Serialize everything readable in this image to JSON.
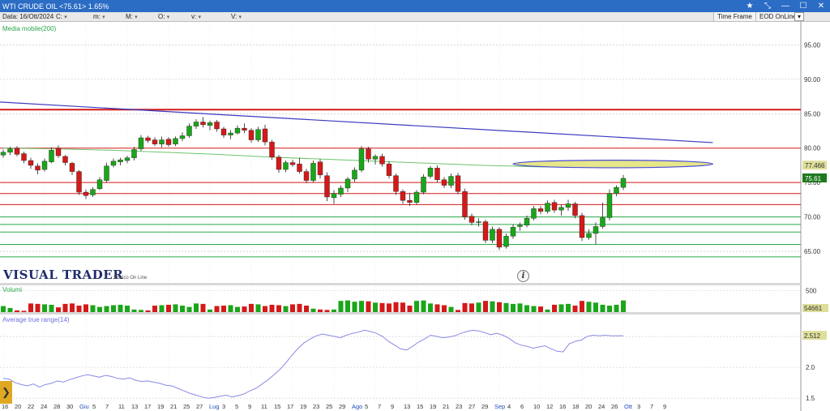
{
  "window": {
    "title": "WTI CRUDE OIL <75.61> 1.65%",
    "star": "★",
    "pin": "⤡",
    "minimize": "—",
    "maximize": "☐",
    "close": "✕"
  },
  "infobar": {
    "date_label": "Data: 16/Ott/2024",
    "c_label": "C:",
    "m_label": "m:",
    "M_label": "M:",
    "o_label": "O:",
    "v_label": "v:",
    "V_label": "V:",
    "timeframe": "Time Frame",
    "source": "EOD OnLine"
  },
  "labels": {
    "ma": "Media mobile(200)",
    "volume": "Volumi",
    "atr": "Average true range(14)",
    "logo": "VISUAL TRADER",
    "logo_sub": "Storico On Line",
    "info": "i",
    "sidetab": "❯"
  },
  "colors": {
    "up": "#1aa61a",
    "down": "#d41919",
    "ma": "#6cc46c",
    "trendline": "#3a3abf",
    "resistance": "#d41919",
    "support": "#2aa84a",
    "atr": "#8a8ae6",
    "ellipse_fill": "#e6e68a",
    "ellipse_stroke": "#4a4ad8"
  },
  "chart_data": [
    {
      "type": "candlestick",
      "title": "WTI CRUDE OIL",
      "x_ticks": [
        "16",
        "20",
        "22",
        "24",
        "28",
        "30",
        "Giu",
        "5",
        "7",
        "11",
        "13",
        "17",
        "19",
        "21",
        "25",
        "27",
        "Lug",
        "3",
        "5",
        "9",
        "11",
        "15",
        "17",
        "19",
        "23",
        "25",
        "29",
        "Ago",
        "5",
        "7",
        "9",
        "13",
        "15",
        "19",
        "21",
        "23",
        "27",
        "29",
        "Sep",
        "4",
        "6",
        "10",
        "12",
        "16",
        "18",
        "20",
        "24",
        "26",
        "Ott",
        "3",
        "7",
        "9"
      ],
      "y_ticks": [
        65,
        70,
        75,
        80,
        85,
        90,
        95
      ],
      "ylim": [
        63.0,
        98.0
      ],
      "last_price": "75.61",
      "ma_value": "77.466",
      "candles": [
        {
          "o": 79.0,
          "h": 79.8,
          "l": 78.6,
          "c": 79.4
        },
        {
          "o": 79.4,
          "h": 80.2,
          "l": 79.0,
          "c": 79.9
        },
        {
          "o": 80.0,
          "h": 80.3,
          "l": 78.8,
          "c": 79.1
        },
        {
          "o": 79.2,
          "h": 79.5,
          "l": 77.8,
          "c": 78.2
        },
        {
          "o": 78.2,
          "h": 78.6,
          "l": 77.0,
          "c": 77.5
        },
        {
          "o": 77.4,
          "h": 77.8,
          "l": 76.2,
          "c": 76.8
        },
        {
          "o": 76.9,
          "h": 78.5,
          "l": 76.6,
          "c": 78.1
        },
        {
          "o": 78.0,
          "h": 80.1,
          "l": 77.8,
          "c": 79.7
        },
        {
          "o": 80.0,
          "h": 80.4,
          "l": 78.6,
          "c": 78.9
        },
        {
          "o": 78.8,
          "h": 79.0,
          "l": 77.5,
          "c": 77.9
        },
        {
          "o": 77.8,
          "h": 78.0,
          "l": 76.1,
          "c": 76.6
        },
        {
          "o": 76.6,
          "h": 76.8,
          "l": 73.2,
          "c": 73.6
        },
        {
          "o": 73.6,
          "h": 74.0,
          "l": 72.6,
          "c": 73.1
        },
        {
          "o": 73.2,
          "h": 74.3,
          "l": 72.9,
          "c": 74.0
        },
        {
          "o": 74.1,
          "h": 75.8,
          "l": 73.9,
          "c": 75.4
        },
        {
          "o": 75.3,
          "h": 77.9,
          "l": 75.0,
          "c": 77.4
        },
        {
          "o": 77.5,
          "h": 78.5,
          "l": 77.2,
          "c": 78.1
        },
        {
          "o": 78.0,
          "h": 78.6,
          "l": 77.5,
          "c": 78.3
        },
        {
          "o": 78.2,
          "h": 78.9,
          "l": 77.8,
          "c": 78.6
        },
        {
          "o": 78.6,
          "h": 80.2,
          "l": 78.2,
          "c": 79.8
        },
        {
          "o": 79.9,
          "h": 81.9,
          "l": 79.6,
          "c": 81.5
        },
        {
          "o": 81.5,
          "h": 81.8,
          "l": 80.8,
          "c": 81.1
        },
        {
          "o": 81.2,
          "h": 81.6,
          "l": 80.3,
          "c": 80.6
        },
        {
          "o": 80.6,
          "h": 81.7,
          "l": 80.1,
          "c": 81.2
        },
        {
          "o": 81.3,
          "h": 81.6,
          "l": 80.2,
          "c": 80.5
        },
        {
          "o": 80.6,
          "h": 81.7,
          "l": 80.3,
          "c": 81.4
        },
        {
          "o": 81.4,
          "h": 82.3,
          "l": 81.0,
          "c": 81.8
        },
        {
          "o": 81.8,
          "h": 83.6,
          "l": 81.5,
          "c": 83.2
        },
        {
          "o": 83.2,
          "h": 84.2,
          "l": 82.8,
          "c": 83.8
        },
        {
          "o": 83.8,
          "h": 84.5,
          "l": 83.0,
          "c": 83.4
        },
        {
          "o": 83.3,
          "h": 84.0,
          "l": 82.6,
          "c": 83.7
        },
        {
          "o": 83.8,
          "h": 84.1,
          "l": 82.4,
          "c": 82.8
        },
        {
          "o": 82.8,
          "h": 83.1,
          "l": 81.5,
          "c": 81.9
        },
        {
          "o": 81.9,
          "h": 82.6,
          "l": 81.3,
          "c": 82.2
        },
        {
          "o": 82.2,
          "h": 83.3,
          "l": 82.0,
          "c": 82.9
        },
        {
          "o": 82.9,
          "h": 83.6,
          "l": 82.2,
          "c": 82.6
        },
        {
          "o": 82.6,
          "h": 82.9,
          "l": 80.8,
          "c": 81.2
        },
        {
          "o": 81.2,
          "h": 83.1,
          "l": 80.9,
          "c": 82.7
        },
        {
          "o": 82.8,
          "h": 83.4,
          "l": 80.4,
          "c": 80.9
        },
        {
          "o": 80.9,
          "h": 81.2,
          "l": 78.3,
          "c": 78.7
        },
        {
          "o": 78.7,
          "h": 79.0,
          "l": 76.4,
          "c": 76.9
        },
        {
          "o": 76.9,
          "h": 78.2,
          "l": 76.5,
          "c": 77.9
        },
        {
          "o": 77.9,
          "h": 78.3,
          "l": 77.3,
          "c": 77.6
        },
        {
          "o": 77.7,
          "h": 78.6,
          "l": 76.3,
          "c": 76.6
        },
        {
          "o": 76.6,
          "h": 77.0,
          "l": 74.9,
          "c": 75.3
        },
        {
          "o": 75.3,
          "h": 78.2,
          "l": 75.0,
          "c": 77.8
        },
        {
          "o": 78.0,
          "h": 78.4,
          "l": 75.6,
          "c": 76.1
        },
        {
          "o": 76.0,
          "h": 76.5,
          "l": 72.3,
          "c": 72.9
        },
        {
          "o": 72.8,
          "h": 73.9,
          "l": 71.9,
          "c": 73.4
        },
        {
          "o": 73.3,
          "h": 74.6,
          "l": 72.9,
          "c": 74.2
        },
        {
          "o": 74.2,
          "h": 75.8,
          "l": 73.6,
          "c": 75.5
        },
        {
          "o": 75.5,
          "h": 77.2,
          "l": 75.1,
          "c": 76.8
        },
        {
          "o": 76.8,
          "h": 80.3,
          "l": 76.5,
          "c": 79.9
        },
        {
          "o": 79.9,
          "h": 80.2,
          "l": 77.9,
          "c": 78.4
        },
        {
          "o": 78.4,
          "h": 79.1,
          "l": 77.6,
          "c": 78.8
        },
        {
          "o": 78.8,
          "h": 79.2,
          "l": 77.3,
          "c": 77.7
        },
        {
          "o": 77.7,
          "h": 78.1,
          "l": 75.6,
          "c": 76.0
        },
        {
          "o": 76.0,
          "h": 76.3,
          "l": 73.2,
          "c": 73.7
        },
        {
          "o": 73.7,
          "h": 74.0,
          "l": 71.9,
          "c": 72.4
        },
        {
          "o": 72.4,
          "h": 73.5,
          "l": 71.6,
          "c": 72.1
        },
        {
          "o": 72.1,
          "h": 73.9,
          "l": 71.8,
          "c": 73.6
        },
        {
          "o": 73.6,
          "h": 76.2,
          "l": 73.3,
          "c": 75.8
        },
        {
          "o": 75.9,
          "h": 77.4,
          "l": 75.6,
          "c": 77.1
        },
        {
          "o": 77.1,
          "h": 77.5,
          "l": 75.0,
          "c": 75.4
        },
        {
          "o": 75.4,
          "h": 75.8,
          "l": 74.2,
          "c": 74.6
        },
        {
          "o": 74.6,
          "h": 76.3,
          "l": 74.2,
          "c": 75.9
        },
        {
          "o": 76.0,
          "h": 76.4,
          "l": 73.3,
          "c": 73.7
        },
        {
          "o": 73.7,
          "h": 74.1,
          "l": 69.6,
          "c": 70.0
        },
        {
          "o": 70.1,
          "h": 70.5,
          "l": 68.8,
          "c": 69.2
        },
        {
          "o": 69.2,
          "h": 69.8,
          "l": 68.6,
          "c": 69.3
        },
        {
          "o": 69.3,
          "h": 69.6,
          "l": 66.2,
          "c": 66.6
        },
        {
          "o": 66.6,
          "h": 68.6,
          "l": 66.2,
          "c": 68.2
        },
        {
          "o": 68.2,
          "h": 68.5,
          "l": 65.2,
          "c": 65.6
        },
        {
          "o": 65.7,
          "h": 67.6,
          "l": 65.4,
          "c": 67.2
        },
        {
          "o": 67.2,
          "h": 68.9,
          "l": 66.8,
          "c": 68.5
        },
        {
          "o": 68.6,
          "h": 69.2,
          "l": 68.0,
          "c": 68.8
        },
        {
          "o": 68.8,
          "h": 70.2,
          "l": 68.5,
          "c": 69.8
        },
        {
          "o": 69.8,
          "h": 71.6,
          "l": 69.5,
          "c": 71.2
        },
        {
          "o": 71.2,
          "h": 71.6,
          "l": 70.4,
          "c": 70.8
        },
        {
          "o": 70.8,
          "h": 72.4,
          "l": 70.5,
          "c": 72.0
        },
        {
          "o": 72.1,
          "h": 72.5,
          "l": 70.6,
          "c": 71.0
        },
        {
          "o": 71.0,
          "h": 71.8,
          "l": 70.2,
          "c": 71.4
        },
        {
          "o": 71.4,
          "h": 72.5,
          "l": 70.9,
          "c": 71.9
        },
        {
          "o": 71.9,
          "h": 72.2,
          "l": 69.8,
          "c": 70.2
        },
        {
          "o": 70.2,
          "h": 70.6,
          "l": 66.5,
          "c": 67.0
        },
        {
          "o": 67.0,
          "h": 68.2,
          "l": 66.7,
          "c": 67.6
        },
        {
          "o": 67.6,
          "h": 69.2,
          "l": 66.0,
          "c": 68.6
        },
        {
          "o": 68.6,
          "h": 72.1,
          "l": 68.3,
          "c": 69.9
        },
        {
          "o": 69.9,
          "h": 74.0,
          "l": 69.5,
          "c": 73.4
        },
        {
          "o": 73.4,
          "h": 74.6,
          "l": 73.0,
          "c": 74.3
        },
        {
          "o": 74.3,
          "h": 76.1,
          "l": 73.9,
          "c": 75.61
        }
      ],
      "moving_average_200": [
        80.0,
        79.9,
        79.7,
        79.4,
        79.1,
        78.7,
        78.4,
        78.1,
        77.8,
        77.5,
        77.3,
        77.2
      ],
      "horizontal_levels": [
        {
          "value": 85.6,
          "color": "#d41919",
          "width": 2
        },
        {
          "value": 80.0,
          "color": "#d41919",
          "width": 1
        },
        {
          "value": 75.0,
          "color": "#d41919",
          "width": 1
        },
        {
          "value": 73.4,
          "color": "#d41919",
          "width": 1
        },
        {
          "value": 71.8,
          "color": "#d41919",
          "width": 1
        },
        {
          "value": 70.0,
          "color": "#2aa84a",
          "width": 1
        },
        {
          "value": 68.9,
          "color": "#2aa84a",
          "width": 1
        },
        {
          "value": 67.8,
          "color": "#2aa84a",
          "width": 1
        },
        {
          "value": 66.0,
          "color": "#2aa84a",
          "width": 1
        },
        {
          "value": 64.2,
          "color": "#2aa84a",
          "width": 1
        }
      ],
      "trendline": {
        "from": {
          "index": 0,
          "value": 86.7
        },
        "to": {
          "index": 103,
          "value": 80.8
        }
      },
      "ellipse": {
        "center_index": 88.5,
        "value": 77.7,
        "half_width_candles": 14.5,
        "half_height_value": 0.55
      }
    },
    {
      "type": "bar",
      "title": "Volumi",
      "y_ticks": [
        500
      ],
      "last_value": "54661",
      "ylim": [
        0,
        620
      ],
      "values": [
        140,
        95,
        40,
        30,
        200,
        190,
        180,
        170,
        110,
        190,
        200,
        150,
        180,
        160,
        120,
        140,
        160,
        170,
        150,
        60,
        50,
        40,
        150,
        160,
        170,
        180,
        150,
        120,
        200,
        190,
        60,
        140,
        150,
        160,
        120,
        130,
        190,
        180,
        140,
        170,
        160,
        140,
        180,
        190,
        150,
        80,
        60,
        50,
        60,
        260,
        270,
        240,
        260,
        250,
        220,
        210,
        200,
        230,
        220,
        150,
        260,
        270,
        200,
        180,
        160,
        120,
        50,
        210,
        200,
        220,
        260,
        250,
        230,
        210,
        190,
        200,
        160,
        140,
        130,
        60,
        170,
        180,
        190,
        150,
        260,
        240,
        220,
        170,
        150,
        170,
        270,
        250,
        210,
        170,
        390,
        260,
        250,
        230,
        20,
        40,
        60,
        30,
        20,
        20
      ],
      "colors_up_down": "alternating by candle direction"
    },
    {
      "type": "line",
      "title": "Average true range(14)",
      "y_ticks": [
        1.5,
        2.0,
        2.5
      ],
      "last_value": "2.512",
      "ylim": [
        1.45,
        2.75
      ],
      "values": [
        1.82,
        1.81,
        1.75,
        1.72,
        1.7,
        1.73,
        1.68,
        1.72,
        1.74,
        1.78,
        1.76,
        1.8,
        1.83,
        1.86,
        1.88,
        1.86,
        1.84,
        1.87,
        1.85,
        1.82,
        1.81,
        1.83,
        1.79,
        1.77,
        1.78,
        1.76,
        1.74,
        1.71,
        1.7,
        1.66,
        1.62,
        1.58,
        1.55,
        1.52,
        1.5,
        1.51,
        1.53,
        1.55,
        1.52,
        1.54,
        1.57,
        1.62,
        1.66,
        1.73,
        1.8,
        1.88,
        1.97,
        2.08,
        2.2,
        2.31,
        2.4,
        2.46,
        2.51,
        2.54,
        2.52,
        2.5,
        2.48,
        2.52,
        2.55,
        2.57,
        2.6,
        2.58,
        2.55,
        2.5,
        2.42,
        2.36,
        2.3,
        2.28,
        2.34,
        2.41,
        2.46,
        2.52,
        2.5,
        2.48,
        2.49,
        2.51,
        2.55,
        2.58,
        2.6,
        2.59,
        2.56,
        2.53,
        2.55,
        2.52,
        2.47,
        2.4,
        2.36,
        2.34,
        2.31,
        2.33,
        2.35,
        2.3,
        2.26,
        2.25,
        2.38,
        2.42,
        2.44,
        2.5,
        2.52,
        2.51,
        2.52,
        2.51,
        2.51,
        2.512
      ]
    }
  ]
}
